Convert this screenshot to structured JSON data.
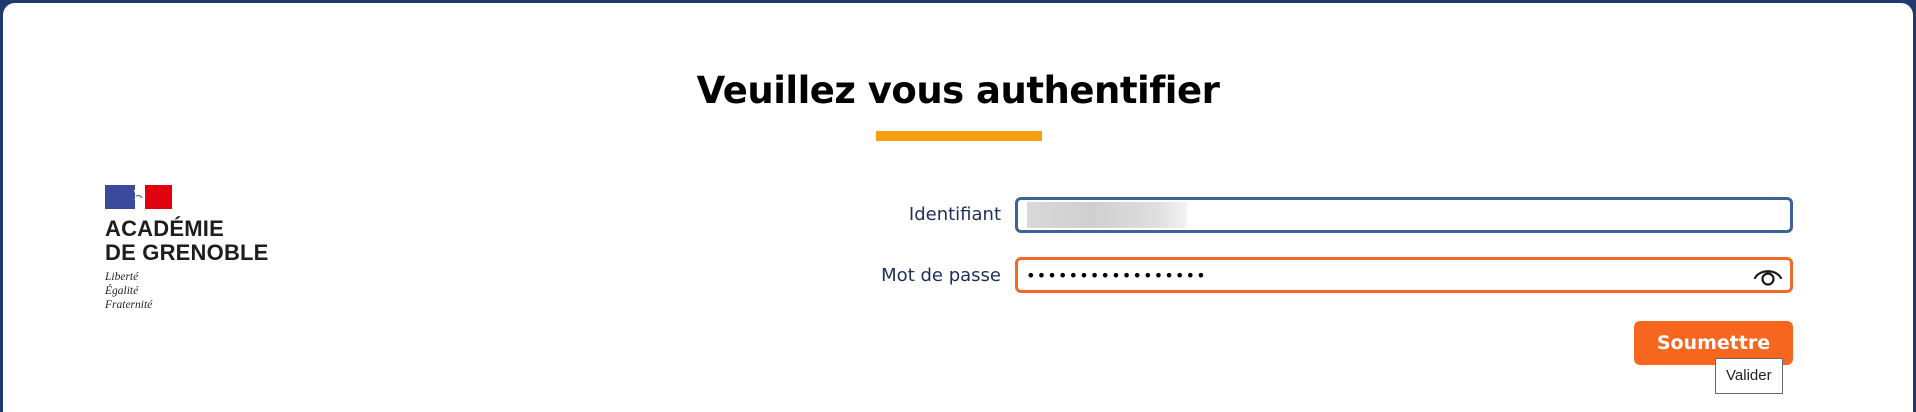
{
  "page": {
    "title": "Veuillez vous authentifier",
    "accent_color": "#f5a10f"
  },
  "logo": {
    "name_line1": "ACADÉMIE",
    "name_line2": "DE GRENOBLE",
    "motto_line1": "Liberté",
    "motto_line2": "Égalité",
    "motto_line3": "Fraternité"
  },
  "form": {
    "identifier_label": "Identifiant",
    "identifier_value": "c",
    "password_label": "Mot de passe",
    "password_value": "•••••••••••••••••",
    "show_password_icon": "eye-icon",
    "submit_label": "Soumettre",
    "submit_color": "#f6661e",
    "submit_tooltip": "Valider"
  }
}
